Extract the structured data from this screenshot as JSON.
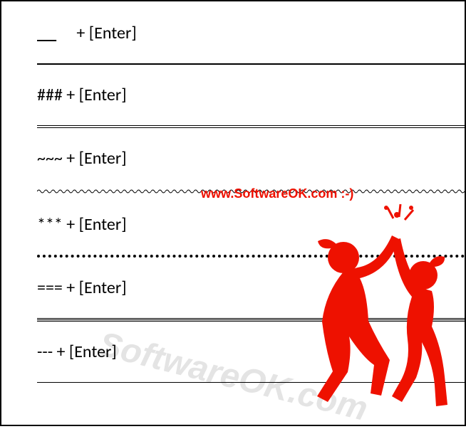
{
  "shortcuts": {
    "row0": {
      "text": " + [Enter]"
    },
    "row1": {
      "text": "### + [Enter]"
    },
    "row2": {
      "text": "~~~ + [Enter]"
    },
    "row3": {
      "text": "*** + [Enter]"
    },
    "row4": {
      "text": "=== + [Enter]"
    },
    "row5": {
      "text": "--- + [Enter]"
    }
  },
  "brand": "www.SoftwareOK.com :-)",
  "watermark": "SoftwareOK.com"
}
